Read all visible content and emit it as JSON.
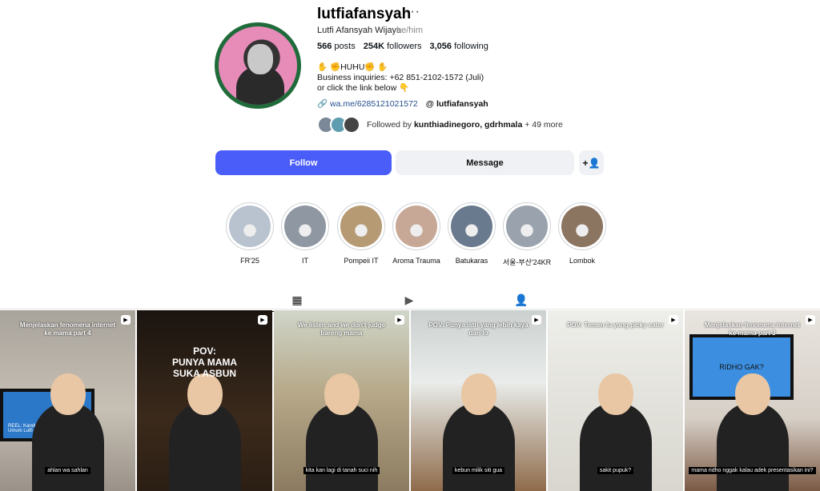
{
  "profile": {
    "username": "lutfiafansyah",
    "more_glyph": "···",
    "full_name": "Lutfi Afansyah Wijaya",
    "pronouns": "he/him",
    "posts_count": "566",
    "posts_label": "posts",
    "followers_count": "254K",
    "followers_label": "followers",
    "following_count": "3,056",
    "following_label": "following",
    "bio_line1": "✋ ✊HUHU✊ ✋",
    "bio_line2": "Business inquiries: +62 851-2102-1572 (Juli)",
    "bio_line3": "or click the link below 👇",
    "link_icon": "🔗",
    "link_url": "wa.me/6285121021572",
    "threads_icon": "@",
    "threads_handle": "lutfiafansyah",
    "followed_by_prefix": "Followed by",
    "followed_by_names": "kunthiadinegoro, gdrhmala",
    "followed_by_more": "+ 49 more"
  },
  "actions": {
    "follow_label": "Follow",
    "message_label": "Message",
    "add_user_glyph": "+👤"
  },
  "highlights": [
    {
      "label": "FR'25",
      "color": "#b9c3cf"
    },
    {
      "label": "IT",
      "color": "#8f97a3"
    },
    {
      "label": "Pompeii IT",
      "color": "#b69a74"
    },
    {
      "label": "Aroma Trauma",
      "color": "#c7a896"
    },
    {
      "label": "Batukaras",
      "color": "#6a7a8e"
    },
    {
      "label": "서울-부산'24KR",
      "color": "#9aa3ad"
    },
    {
      "label": "Lombok",
      "color": "#8b7561"
    }
  ],
  "tabs": {
    "posts_icon": "▦",
    "reels_icon": "▶",
    "tagged_icon": "👤"
  },
  "posts": [
    {
      "top": "Menjelaskan fenomena internet ke mama part 4",
      "big": "",
      "bottom": "ahlan wa sahlan",
      "screen": "REEL: Kandumer Pengelolaan Umum Lutfi"
    },
    {
      "top": "",
      "big": "POV:\nPUNYA MAMA\nSUKA ASBUN",
      "bottom": ""
    },
    {
      "top": "We listen and we don't judge bareng mama",
      "big": "",
      "bottom": "kita kan lagi di tanah suci nih"
    },
    {
      "top": "POV: Punya istri yang lebih kaya dari lo",
      "big": "",
      "bottom": "kebun milik siti gua"
    },
    {
      "top": "POV: Temen lu yang picky eater",
      "big": "",
      "bottom": "sakit pupuk?"
    },
    {
      "top": "Menjelaskan fenomena internet ke mama part 3",
      "big": "",
      "bottom": "mama ridho nggak kalau adek presentasikan ini?",
      "screen": "RIDHO GAK?"
    }
  ],
  "reel_icon": "▶"
}
